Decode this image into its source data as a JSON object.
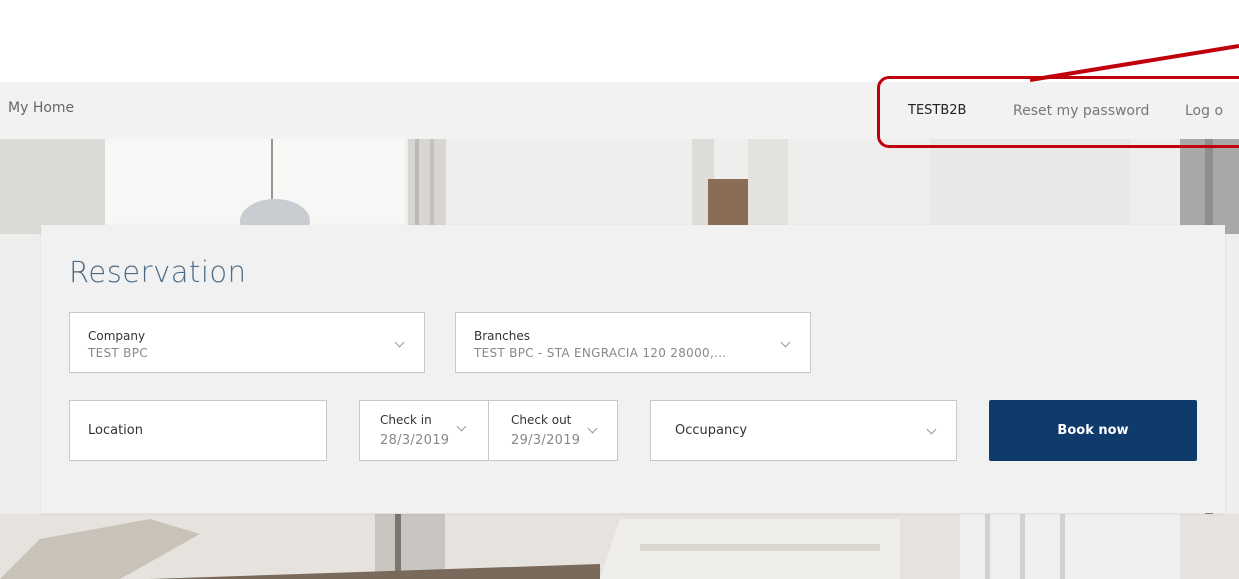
{
  "nav": {
    "home_label": "My Home",
    "user_label": "TESTB2B",
    "reset_label": "Reset my password",
    "logout_label": "Log o"
  },
  "reservation": {
    "title": "Reservation",
    "company": {
      "label": "Company",
      "value": "TEST BPC"
    },
    "branches": {
      "label": "Branches",
      "value": "TEST BPC - STA ENGRACIA 120 28000,..."
    },
    "location": {
      "label": "Location"
    },
    "check_in": {
      "label": "Check in",
      "value": "28/3/2019"
    },
    "check_out": {
      "label": "Check out",
      "value": "29/3/2019"
    },
    "occupancy": {
      "label": "Occupancy"
    },
    "book_label": "Book now"
  },
  "colors": {
    "accent": "#0e3a6c",
    "title": "#4c6b86",
    "annotation": "#c0000b",
    "navbar_bg": "#f2f2f2"
  }
}
